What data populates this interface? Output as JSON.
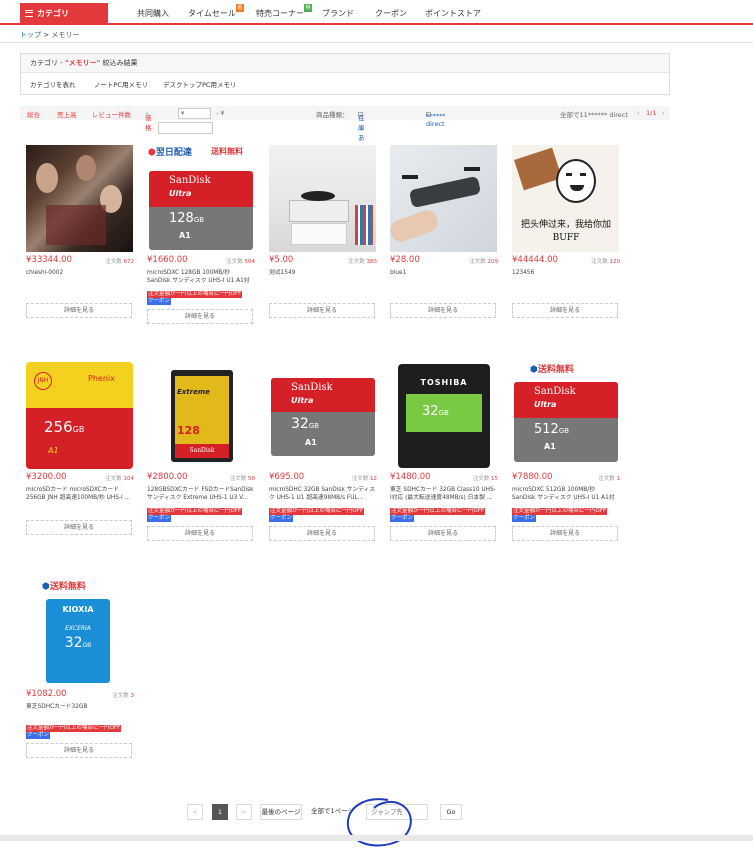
{
  "nav": {
    "category_label": "カテゴリ",
    "items": [
      "共同購入",
      "タイムセール",
      "特売コーナー",
      "ブランド",
      "クーポン",
      "ポイントストア"
    ],
    "badges": {
      "timesale": "限",
      "tokubai": "特"
    }
  },
  "breadcrumb": {
    "home": "トップ",
    "sep": " > ",
    "current": "メモリー"
  },
  "filter": {
    "head_prefix": "カテゴリ - ",
    "keyword": "\"メモリー\"",
    "head_suffix": " 絞込み結果",
    "tabs": [
      "カテゴリを表れ",
      "ノートPC用メモリ",
      "デスクトップPC用メモリ"
    ]
  },
  "sortbar": {
    "overall": "総合",
    "sales": "売上高",
    "reviews": "レビュー件数",
    "price": "価格",
    "price_placeholder": "¥",
    "price_dash": "- ¥",
    "delivery_label": "商品種類：",
    "in_stock": "在庫ありのみ表示",
    "direct": "****** direct",
    "total": "全部で11****** direct",
    "page": "1/1"
  },
  "products": [
    {
      "price": "¥33344.00",
      "orders_label": "注文数",
      "orders": "672",
      "title": "chieshi-0002",
      "promo": false,
      "detail": "詳細を見る",
      "image": "photo-people"
    },
    {
      "price": "¥1660.00",
      "orders_label": "注文数",
      "orders": "504",
      "title": "microSDXC 128GB 100MB/秒 SanDisk サンディスク UHS-I U1 A1対応 ...",
      "promo": true,
      "promo_text": "注文金額が一円以上の場合に一円OFF",
      "coupon": "クーポン",
      "detail": "詳細を見る",
      "image": "sandisk-128"
    },
    {
      "price": "¥5.00",
      "orders_label": "注文数",
      "orders": "383",
      "title": "测试1549",
      "promo": false,
      "detail": "詳細を見る",
      "image": "record-player"
    },
    {
      "price": "¥28.00",
      "orders_label": "注文数",
      "orders": "209",
      "title": "blue1",
      "promo": false,
      "detail": "詳細を見る",
      "image": "drone"
    },
    {
      "price": "¥44444.00",
      "orders_label": "注文数",
      "orders": "120",
      "title": "123456",
      "promo": false,
      "detail": "詳細を見る",
      "image": "meme"
    },
    {
      "price": "¥3200.00",
      "orders_label": "注文数",
      "orders": "104",
      "title": "microSDカード microSDXCカード 256GB JNH 超高速100MB/秒 UHS-I ...",
      "promo": false,
      "detail": "詳細を見る",
      "image": "jnh-256"
    },
    {
      "price": "¥2800.00",
      "orders_label": "注文数",
      "orders": "50",
      "title": "128GBSDXCカード FSDカードSanDisk サンディスク Extreme UHS-1 U3 V...",
      "promo": true,
      "promo_text": "注文金額が一円以上の場合に一円OFF",
      "coupon": "クーポン",
      "detail": "詳細を見る",
      "image": "sandisk-extreme"
    },
    {
      "price": "¥695.00",
      "orders_label": "注文数",
      "orders": "12",
      "title": "microSDHC 32GB SanDisk サンディスク UHS-1 U1 超高速98MB/s FUL...",
      "promo": true,
      "promo_text": "注文金額が一円以上の場合に一円OFF",
      "coupon": "クーポン",
      "detail": "詳細を見る",
      "image": "sandisk-32"
    },
    {
      "price": "¥1480.00",
      "orders_label": "注文数",
      "orders": "15",
      "title": "東芝 SDHCカード 32GB Class10 UHS-I対応 (最大転送速度48MB/s) 日本製 ...",
      "promo": true,
      "promo_text": "注文金額が一円以上の場合に一円OFF",
      "coupon": "クーポン",
      "detail": "詳細を見る",
      "image": "toshiba-32"
    },
    {
      "price": "¥7880.00",
      "orders_label": "注文数",
      "orders": "1",
      "title": "microSDXC 512GB 100MB/秒 SanDisk サンディスク UHS-I U1 A1対応 ...",
      "promo": true,
      "promo_text": "注文金額が一円以上の場合に一円OFF",
      "coupon": "クーポン",
      "detail": "詳細を見る",
      "image": "sandisk-512"
    },
    {
      "price": "¥1082.00",
      "orders_label": "注文数",
      "orders": "3",
      "title": "東芝SDHCカード32GB",
      "promo": true,
      "promo_text": "注文金額が一円以上の場合に一円OFF",
      "coupon": "クーポン",
      "detail": "詳細を見る",
      "image": "kioxia-32"
    }
  ],
  "image_text": {
    "next_day": "翌日配達",
    "free_ship": "送料無料",
    "sandisk": "SanDisk",
    "ultra": "Ultra",
    "extreme": "Extreme",
    "cap128": "128",
    "cap32": "32",
    "cap512": "512",
    "cap256": "256",
    "gb": "GB",
    "a1": "A1",
    "toshiba": "TOSHIBA",
    "kioxia": "KIOXIA",
    "exceria": "EXCERIA",
    "jnh": "JNH",
    "phenix": "Phenix",
    "meme_text": "把头伸过来，我给你加BUFF"
  },
  "pager": {
    "prev": "<",
    "current": "1",
    "next": ">",
    "last_page": "最後のページ",
    "total_pages": "全部で1ページ",
    "jump_placeholder": "ジャンプ先",
    "go": "Go"
  },
  "colors": {
    "accent": "#e4393c",
    "link": "#1a5fb4",
    "coupon": "#3b6ee8"
  }
}
